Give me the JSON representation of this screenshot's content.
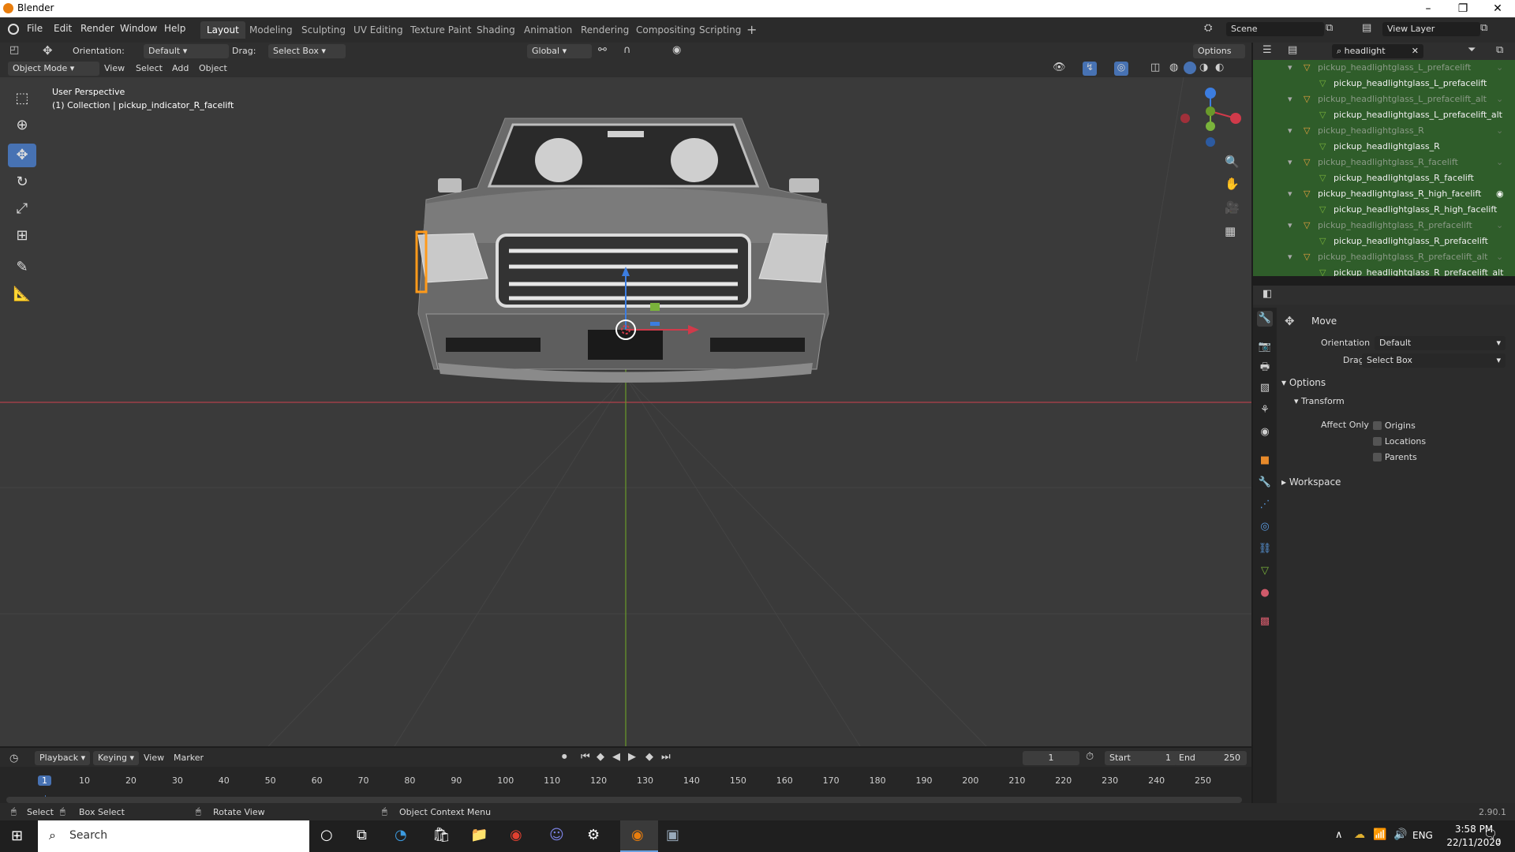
{
  "app": {
    "title": "Blender",
    "version": "2.90.1"
  },
  "menu": [
    "File",
    "Edit",
    "Render",
    "Window",
    "Help"
  ],
  "workspaces": [
    "Layout",
    "Modeling",
    "Sculpting",
    "UV Editing",
    "Texture Paint",
    "Shading",
    "Animation",
    "Rendering",
    "Compositing",
    "Scripting"
  ],
  "scene": {
    "label": "Scene",
    "view_layer": "View Layer"
  },
  "tool_header": {
    "orientation_label": "Orientation:",
    "orientation_value": "Default",
    "drag_label": "Drag:",
    "drag_value": "Select Box",
    "transform_orientation": "Global",
    "options": "Options"
  },
  "viewport_header": {
    "mode": "Object Mode",
    "menus": [
      "View",
      "Select",
      "Add",
      "Object"
    ]
  },
  "viewport": {
    "perspective": "User Perspective",
    "collection": "(1) Collection | pickup_indicator_R_facelift"
  },
  "outliner": {
    "search": "headlight",
    "rows": [
      {
        "name": "pickup_headlightglass_L_prefacelift",
        "child": false,
        "dim": true
      },
      {
        "name": "pickup_headlightglass_L_prefacelift",
        "child": true,
        "dim": false
      },
      {
        "name": "pickup_headlightglass_L_prefacelift_alt",
        "child": false,
        "dim": true
      },
      {
        "name": "pickup_headlightglass_L_prefacelift_alt",
        "child": true,
        "dim": false
      },
      {
        "name": "pickup_headlightglass_R",
        "child": false,
        "dim": true
      },
      {
        "name": "pickup_headlightglass_R",
        "child": true,
        "dim": false
      },
      {
        "name": "pickup_headlightglass_R_facelift",
        "child": false,
        "dim": true
      },
      {
        "name": "pickup_headlightglass_R_facelift",
        "child": true,
        "dim": false
      },
      {
        "name": "pickup_headlightglass_R_high_facelift",
        "child": false,
        "dim": false
      },
      {
        "name": "pickup_headlightglass_R_high_facelift",
        "child": true,
        "dim": false
      },
      {
        "name": "pickup_headlightglass_R_prefacelift",
        "child": false,
        "dim": true
      },
      {
        "name": "pickup_headlightglass_R_prefacelift",
        "child": true,
        "dim": false
      },
      {
        "name": "pickup_headlightglass_R_prefacelift_alt",
        "child": false,
        "dim": true
      },
      {
        "name": "pickup_headlightglass_R_prefacelift_alt",
        "child": true,
        "dim": false
      }
    ]
  },
  "properties": {
    "tool_name": "Move",
    "orientation_label": "Orientation",
    "orientation_value": "Default",
    "drag_label": "Drag:",
    "drag_value": "Select Box",
    "options_panel": "Options",
    "transform_panel": "Transform",
    "affect_only": "Affect Only",
    "checks": [
      "Origins",
      "Locations",
      "Parents"
    ],
    "workspace_panel": "Workspace"
  },
  "timeline": {
    "menus": [
      "Playback",
      "Keying",
      "View",
      "Marker"
    ],
    "current_frame": "1",
    "start_label": "Start",
    "start": "1",
    "end_label": "End",
    "end": "250",
    "ticks": [
      "1",
      "10",
      "20",
      "30",
      "40",
      "50",
      "60",
      "70",
      "80",
      "90",
      "100",
      "110",
      "120",
      "130",
      "140",
      "150",
      "160",
      "170",
      "180",
      "190",
      "200",
      "210",
      "220",
      "230",
      "240",
      "250"
    ]
  },
  "status": {
    "select": "Select",
    "box_select": "Box Select",
    "rotate_view": "Rotate View",
    "context_menu": "Object Context Menu"
  },
  "taskbar": {
    "search": "Search",
    "lang": "ENG",
    "time": "3:58 PM",
    "date": "22/11/2020",
    "notifications": "3"
  },
  "colors": {
    "accent": "#4772b3",
    "outliner_selected": "#2f5d2a",
    "x_axis": "#d03a4a",
    "y_axis": "#7ab33b",
    "z_axis": "#3c7de0"
  }
}
